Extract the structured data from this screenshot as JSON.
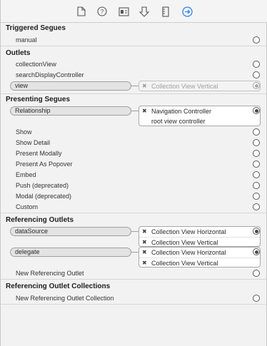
{
  "toolbar": {
    "icons": [
      "file-icon",
      "help-icon",
      "identity-icon",
      "attributes-icon",
      "size-icon",
      "connections-icon"
    ],
    "active_index": 5,
    "accent": "#2f7ff2"
  },
  "triggered_segues": {
    "title": "Triggered Segues",
    "rows": [
      "manual"
    ]
  },
  "outlets": {
    "title": "Outlets",
    "rows": [
      "collectionView",
      "searchDisplayController"
    ],
    "connected": {
      "label": "view",
      "target": "Collection View Vertical"
    }
  },
  "presenting_segues": {
    "title": "Presenting Segues",
    "relationship": {
      "label": "Relationship",
      "targets": [
        "Navigation Controller",
        "root view controller"
      ]
    },
    "rows": [
      "Show",
      "Show Detail",
      "Present Modally",
      "Present As Popover",
      "Embed",
      "Push (deprecated)",
      "Modal (deprecated)",
      "Custom"
    ]
  },
  "referencing_outlets": {
    "title": "Referencing Outlets",
    "connections": [
      {
        "label": "dataSource",
        "targets": [
          "Collection View Horizontal",
          "Collection View Vertical"
        ]
      },
      {
        "label": "delegate",
        "targets": [
          "Collection View Horizontal",
          "Collection View Vertical"
        ]
      }
    ],
    "new_label": "New Referencing Outlet"
  },
  "referencing_outlet_collections": {
    "title": "Referencing Outlet Collections",
    "new_label": "New Referencing Outlet Collection"
  }
}
